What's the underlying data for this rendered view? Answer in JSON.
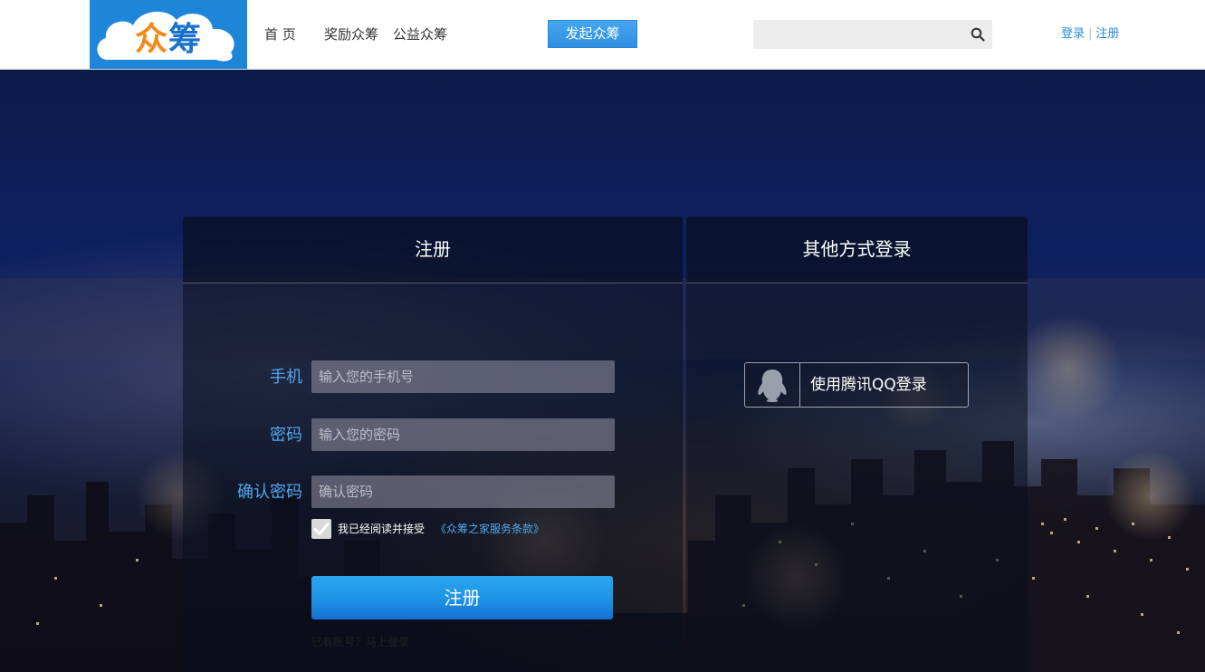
{
  "header": {
    "logo_text_first": "众",
    "logo_text_rest": "筹",
    "nav": [
      "首 页",
      "奖励众筹",
      "公益众筹"
    ],
    "launch_label": "发起众筹",
    "search": {
      "value": "",
      "placeholder": ""
    },
    "auth": {
      "login": "登录",
      "separator": "|",
      "register": "注册"
    }
  },
  "register_panel": {
    "title": "注册",
    "fields": [
      {
        "label": "手机",
        "placeholder": "输入您的手机号"
      },
      {
        "label": "密码",
        "placeholder": "输入您的密码"
      },
      {
        "label": "确认密码",
        "placeholder": "确认密码"
      }
    ],
    "agree_checked": true,
    "agree_text": "我已经阅读并接受",
    "terms_link": "《众筹之家服务条款》",
    "submit_label": "注册",
    "hint_prefix": "已有账号？",
    "hint_link": "马上登录"
  },
  "other_panel": {
    "title": "其他方式登录",
    "qq_label": "使用腾讯QQ登录"
  },
  "colors": {
    "accent": "#2a8bd8",
    "label_blue": "#4fa7ee",
    "button_blue": "#1e92e6",
    "logo_bg": "#1e86d8",
    "logo_orange": "#f28a1a"
  },
  "icons": [
    "search-icon",
    "checkmark-icon",
    "qq-avatar-icon"
  ]
}
